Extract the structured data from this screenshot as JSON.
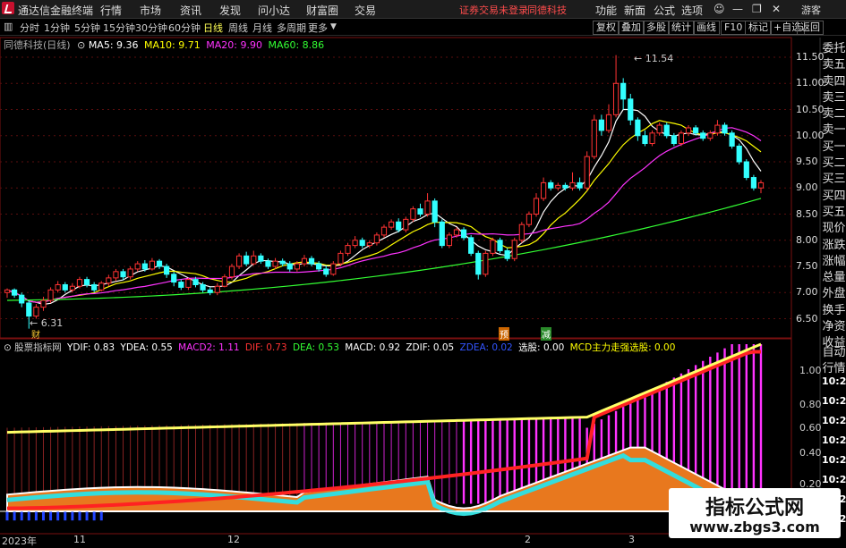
{
  "app": {
    "title": "通达信金融终端",
    "menu": [
      "行情",
      "市场",
      "资讯",
      "发现",
      "问小达",
      "财富圈",
      "交易"
    ],
    "login_status": "证券交易未登录",
    "stock_tag": "同德科技",
    "right_menu": [
      "功能",
      "新面",
      "公式",
      "选项"
    ],
    "guest": "游客"
  },
  "periods": [
    "分时",
    "1分钟",
    "5分钟",
    "15分钟",
    "30分钟",
    "60分钟",
    "日线",
    "周线",
    "月线",
    "多周期",
    "更多"
  ],
  "selected_period": "日线",
  "right_tools": [
    "复权",
    "叠加",
    "多股",
    "统计",
    "画线",
    "F10",
    "标记",
    "+自选",
    "返回"
  ],
  "main_chart": {
    "stock_label": "同德科技(日线)",
    "ma": [
      {
        "label": "MA5: 9.36",
        "color": "#ffffff"
      },
      {
        "label": "MA10: 9.71",
        "color": "#ffff00"
      },
      {
        "label": "MA20: 9.90",
        "color": "#ff33ff"
      },
      {
        "label": "MA60: 8.86",
        "color": "#33ff33"
      }
    ],
    "high_label": "11.54",
    "low_label": "6.31",
    "markers": [
      "财",
      "预",
      "减"
    ],
    "y_ticks": [
      "11.50",
      "11.00",
      "10.50",
      "10.00",
      "9.50",
      "9.00",
      "8.50",
      "8.00",
      "7.50",
      "7.00",
      "6.50"
    ]
  },
  "sub_chart": {
    "name": "股票指标网",
    "items": [
      {
        "label": "YDIF: 0.83",
        "color": "#ffffff"
      },
      {
        "label": "YDEA: 0.55",
        "color": "#ffffff"
      },
      {
        "label": "MACD2: 1.11",
        "color": "#ff33ff"
      },
      {
        "label": "DIF: 0.73",
        "color": "#ff3333"
      },
      {
        "label": "DEA: 0.53",
        "color": "#33ff33"
      },
      {
        "label": "MACD: 0.92",
        "color": "#ffffff"
      },
      {
        "label": "ZDIF: 0.05",
        "color": "#ffffff"
      },
      {
        "label": "ZDEA: 0.02",
        "color": "#3355ff"
      },
      {
        "label": "选股: 0.00",
        "color": "#ffffff"
      },
      {
        "label": "MCD主力走强选股: 0.00",
        "color": "#ffff00"
      }
    ],
    "y_ticks": [
      "1.00",
      "0.80",
      "0.60",
      "0.40",
      "0.20"
    ],
    "time_labels": [
      "10:27",
      "10:27",
      "10:27",
      "10:27",
      "10:27",
      "10:27",
      "10:27",
      "10:27"
    ]
  },
  "right_panel": [
    "委托",
    "卖五",
    "卖四",
    "卖三",
    "卖二",
    "卖一",
    "买一",
    "买二",
    "买三",
    "买四",
    "买五",
    "现价",
    "涨跌",
    "涨幅",
    "总量",
    "外盘",
    "换手",
    "净资",
    "收益"
  ],
  "right_panel_sub": [
    "自动",
    "行情"
  ],
  "x_axis": [
    "2023年",
    "11",
    "12",
    "2",
    "3"
  ],
  "watermark": {
    "line1": "指标公式网",
    "line2": "www.zbgs3.com"
  },
  "candles": [
    [
      7.0,
      7.05,
      6.9,
      7.08
    ],
    [
      7.05,
      6.95,
      6.9,
      7.08
    ],
    [
      6.95,
      6.8,
      6.72,
      7.0
    ],
    [
      6.8,
      6.55,
      6.31,
      6.85
    ],
    [
      6.55,
      6.72,
      6.5,
      6.78
    ],
    [
      6.72,
      6.85,
      6.65,
      6.92
    ],
    [
      6.85,
      7.05,
      6.8,
      7.1
    ],
    [
      7.05,
      7.15,
      7.0,
      7.22
    ],
    [
      7.15,
      7.05,
      7.0,
      7.2
    ],
    [
      7.05,
      7.12,
      7.0,
      7.18
    ],
    [
      7.12,
      7.25,
      7.08,
      7.3
    ],
    [
      7.25,
      7.15,
      7.1,
      7.3
    ],
    [
      7.15,
      7.05,
      7.0,
      7.2
    ],
    [
      7.05,
      7.18,
      7.02,
      7.22
    ],
    [
      7.18,
      7.28,
      7.12,
      7.34
    ],
    [
      7.28,
      7.4,
      7.22,
      7.45
    ],
    [
      7.4,
      7.3,
      7.24,
      7.45
    ],
    [
      7.3,
      7.45,
      7.25,
      7.5
    ],
    [
      7.45,
      7.55,
      7.4,
      7.6
    ],
    [
      7.55,
      7.45,
      7.4,
      7.62
    ],
    [
      7.45,
      7.6,
      7.42,
      7.66
    ],
    [
      7.6,
      7.5,
      7.45,
      7.64
    ],
    [
      7.5,
      7.35,
      7.28,
      7.55
    ],
    [
      7.35,
      7.2,
      7.12,
      7.4
    ],
    [
      7.2,
      7.1,
      7.05,
      7.25
    ],
    [
      7.1,
      7.25,
      7.05,
      7.28
    ],
    [
      7.25,
      7.15,
      7.1,
      7.3
    ],
    [
      7.15,
      7.05,
      7.0,
      7.2
    ],
    [
      7.05,
      7.0,
      6.95,
      7.1
    ],
    [
      7.0,
      7.12,
      6.95,
      7.18
    ],
    [
      7.12,
      7.3,
      7.1,
      7.35
    ],
    [
      7.3,
      7.5,
      7.25,
      7.55
    ],
    [
      7.5,
      7.7,
      7.45,
      7.75
    ],
    [
      7.7,
      7.55,
      7.5,
      7.78
    ],
    [
      7.55,
      7.7,
      7.52,
      7.8
    ],
    [
      7.7,
      7.6,
      7.55,
      7.75
    ],
    [
      7.6,
      7.5,
      7.45,
      7.65
    ],
    [
      7.5,
      7.6,
      7.45,
      7.66
    ],
    [
      7.6,
      7.55,
      7.5,
      7.65
    ],
    [
      7.55,
      7.45,
      7.4,
      7.6
    ],
    [
      7.45,
      7.55,
      7.4,
      7.6
    ],
    [
      7.55,
      7.65,
      7.5,
      7.72
    ],
    [
      7.65,
      7.55,
      7.5,
      7.7
    ],
    [
      7.55,
      7.45,
      7.4,
      7.6
    ],
    [
      7.45,
      7.35,
      7.3,
      7.52
    ],
    [
      7.35,
      7.55,
      7.32,
      7.6
    ],
    [
      7.55,
      7.75,
      7.5,
      7.8
    ],
    [
      7.75,
      7.9,
      7.7,
      7.95
    ],
    [
      7.9,
      8.0,
      7.85,
      8.08
    ],
    [
      8.0,
      7.9,
      7.85,
      8.05
    ],
    [
      7.9,
      7.95,
      7.85,
      8.0
    ],
    [
      7.95,
      8.1,
      7.9,
      8.15
    ],
    [
      8.1,
      8.25,
      8.05,
      8.3
    ],
    [
      8.25,
      8.35,
      8.2,
      8.4
    ],
    [
      8.35,
      8.2,
      8.15,
      8.42
    ],
    [
      8.2,
      8.4,
      8.15,
      8.45
    ],
    [
      8.4,
      8.6,
      8.35,
      8.65
    ],
    [
      8.6,
      8.5,
      8.45,
      8.7
    ],
    [
      8.5,
      8.75,
      8.45,
      8.9
    ],
    [
      8.75,
      8.35,
      8.25,
      8.8
    ],
    [
      8.35,
      7.9,
      7.85,
      8.4
    ],
    [
      7.9,
      8.1,
      7.85,
      8.15
    ],
    [
      8.1,
      8.2,
      8.05,
      8.25
    ],
    [
      8.2,
      8.05,
      8.0,
      8.25
    ],
    [
      8.05,
      7.75,
      7.7,
      8.1
    ],
    [
      7.75,
      7.35,
      7.25,
      7.8
    ],
    [
      7.35,
      7.75,
      7.3,
      7.8
    ],
    [
      7.75,
      8.0,
      7.7,
      8.05
    ],
    [
      8.0,
      7.8,
      7.75,
      8.05
    ],
    [
      7.8,
      7.65,
      7.6,
      7.85
    ],
    [
      7.65,
      8.0,
      7.6,
      8.05
    ],
    [
      8.0,
      8.3,
      7.95,
      8.35
    ],
    [
      8.3,
      8.5,
      8.25,
      8.55
    ],
    [
      8.5,
      8.8,
      8.45,
      8.9
    ],
    [
      8.8,
      9.1,
      8.75,
      9.2
    ],
    [
      9.1,
      9.0,
      8.95,
      9.15
    ],
    [
      9.0,
      9.05,
      8.95,
      9.1
    ],
    [
      9.05,
      9.0,
      8.95,
      9.1
    ],
    [
      9.0,
      9.1,
      8.95,
      9.3
    ],
    [
      9.1,
      9.0,
      8.95,
      9.2
    ],
    [
      9.0,
      9.6,
      8.95,
      9.7
    ],
    [
      9.6,
      10.3,
      9.55,
      10.4
    ],
    [
      10.3,
      10.1,
      10.0,
      10.4
    ],
    [
      10.1,
      10.4,
      10.05,
      10.6
    ],
    [
      10.4,
      11.0,
      10.35,
      11.54
    ],
    [
      11.0,
      10.7,
      10.5,
      11.1
    ],
    [
      10.7,
      10.3,
      10.2,
      10.8
    ],
    [
      10.3,
      10.0,
      9.9,
      10.35
    ],
    [
      10.0,
      9.85,
      9.8,
      10.1
    ],
    [
      9.85,
      10.05,
      9.8,
      10.1
    ],
    [
      10.05,
      10.2,
      10.0,
      10.25
    ],
    [
      10.2,
      10.0,
      9.95,
      10.25
    ],
    [
      10.0,
      9.85,
      9.8,
      10.05
    ],
    [
      9.85,
      10.05,
      9.8,
      10.1
    ],
    [
      10.05,
      10.15,
      10.0,
      10.2
    ],
    [
      10.15,
      10.05,
      10.0,
      10.2
    ],
    [
      10.05,
      9.95,
      9.9,
      10.1
    ],
    [
      9.95,
      10.05,
      9.9,
      10.1
    ],
    [
      10.05,
      10.2,
      10.0,
      10.3
    ],
    [
      10.2,
      10.05,
      10.0,
      10.25
    ],
    [
      10.05,
      9.8,
      9.75,
      10.1
    ],
    [
      9.8,
      9.5,
      9.45,
      9.85
    ],
    [
      9.5,
      9.2,
      9.15,
      9.55
    ],
    [
      9.2,
      9.0,
      8.95,
      9.25
    ],
    [
      9.0,
      9.1,
      8.9,
      9.15
    ]
  ]
}
